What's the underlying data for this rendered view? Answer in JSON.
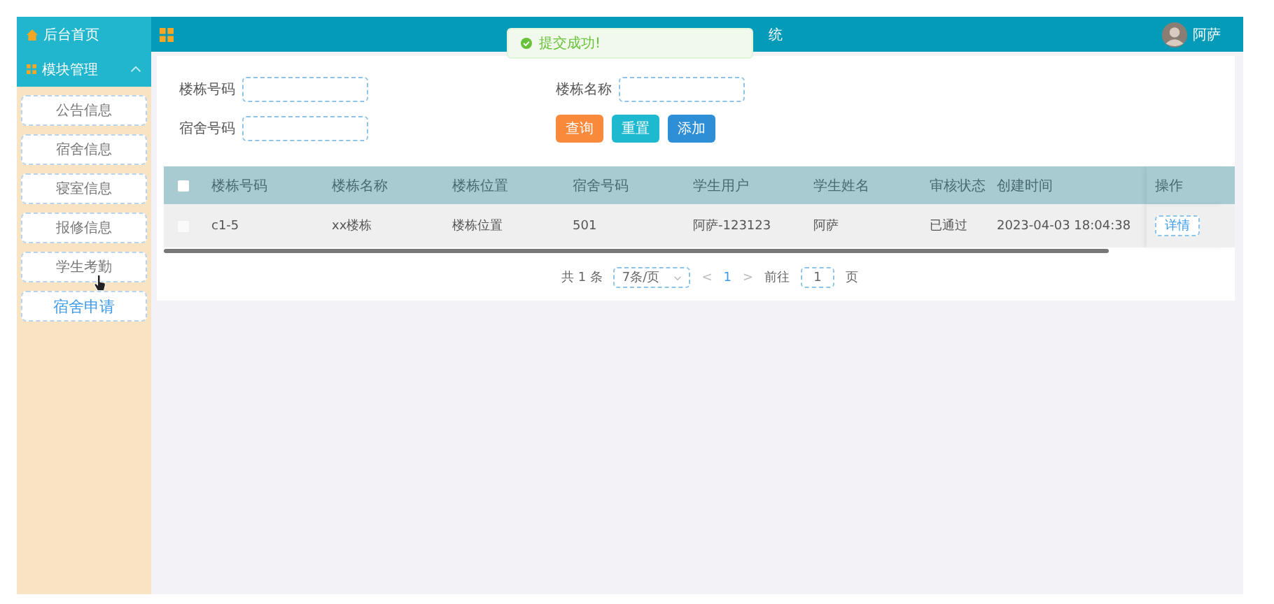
{
  "sidebar": {
    "items": [
      {
        "label": "后台首页",
        "kind": "link"
      },
      {
        "label": "模块管理",
        "kind": "group",
        "expanded": true,
        "children": [
          {
            "label": "公告信息",
            "selected": false
          },
          {
            "label": "宿舍信息",
            "selected": false
          },
          {
            "label": "寝室信息",
            "selected": false
          },
          {
            "label": "报修信息",
            "selected": false
          },
          {
            "label": "学生考勤",
            "selected": false
          },
          {
            "label": "宿舍申请",
            "selected": true
          }
        ]
      }
    ]
  },
  "header": {
    "title_fragment": "统",
    "user": "阿萨"
  },
  "toast": {
    "message": "提交成功!"
  },
  "search": {
    "fields": [
      {
        "label": "楼栋号码"
      },
      {
        "label": "楼栋名称"
      },
      {
        "label": "宿舍号码"
      }
    ],
    "buttons": [
      {
        "label": "查询",
        "kind": "search"
      },
      {
        "label": "重置",
        "kind": "reset"
      },
      {
        "label": "添加",
        "kind": "add"
      }
    ]
  },
  "table": {
    "header_checked": false,
    "columns": [
      "楼栋号码",
      "楼栋名称",
      "楼栋位置",
      "宿舍号码",
      "学生用户",
      "学生姓名",
      "审核状态",
      "创建时间",
      "操作"
    ],
    "rows": [
      {
        "checked": false,
        "cells": [
          "c1-5",
          "xx楼栋",
          "楼栋位置",
          "501",
          "阿萨-123123",
          "阿萨",
          "已通过",
          "2023-04-03 18:04:38"
        ],
        "action": "详情"
      }
    ]
  },
  "pagination": {
    "total": "共 1 条",
    "page_size": "7条/页",
    "prev": "<",
    "current": "1",
    "next": ">",
    "goto_label": "前往",
    "goto_value": "1",
    "page_suffix": "页"
  }
}
